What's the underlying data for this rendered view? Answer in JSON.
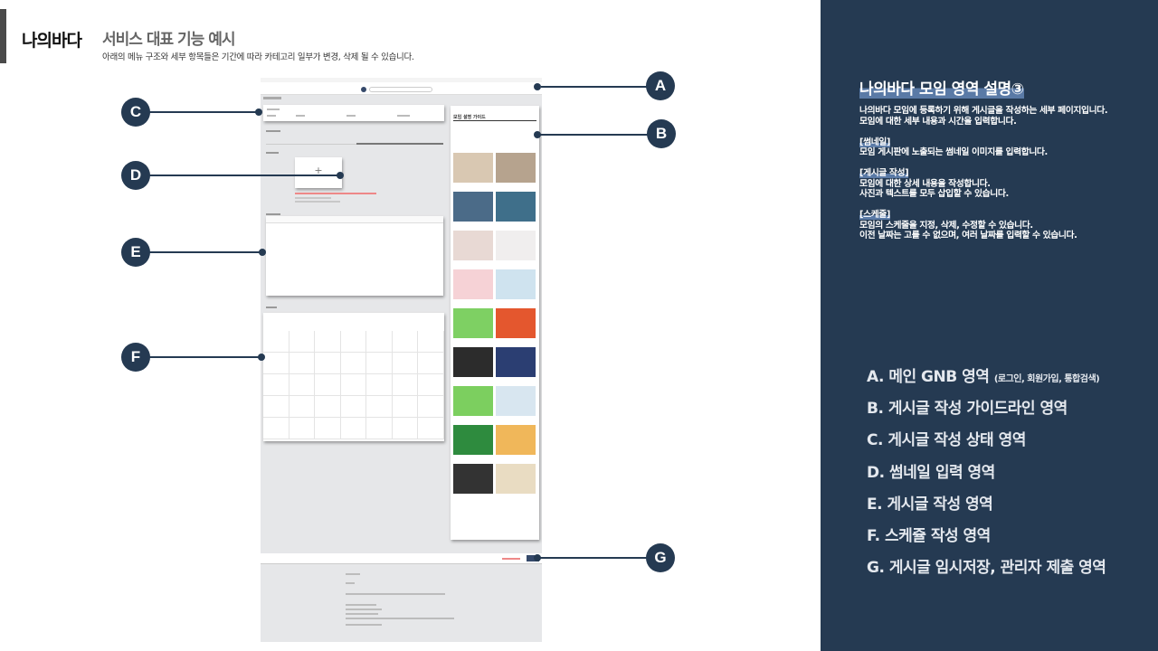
{
  "header": {
    "brand": "나의바다",
    "subtitle": "서비스 대표 기능 예시",
    "description": "아래의 메뉴 구조와 세부 항목들은 기간에 따라 카테고리 일부가 변경, 삭제 될 수 있습니다."
  },
  "mockup": {
    "guide_title": "모임 설명 가이드"
  },
  "markers": {
    "a": "A",
    "b": "B",
    "c": "C",
    "d": "D",
    "e": "E",
    "f": "F",
    "g": "G"
  },
  "panel": {
    "title": "나의바다 모임 영역 설명③",
    "intro_line1": "나의바다 모임에 등록하기 위해 게시글을 작성하는 세부 페이지입니다.",
    "intro_line2": "모임에 대한 세부 내용과 시간을 입력합니다.",
    "thumb_tag": "[썸네일]",
    "thumb_desc": "모임 게시판에 노출되는 썸네일 이미지를 입력합니다.",
    "post_tag": "[게시글 작성]",
    "post_desc1": "모임에 대한 상세 내용을 작성합니다.",
    "post_desc2": "사진과 텍스트를 모두 삽입할 수 있습니다.",
    "sched_tag": "[스케줄]",
    "sched_desc1": "모임의 스케줄을 지정, 삭제, 수정할 수 있습니다.",
    "sched_desc2": "이전 날짜는 고를 수 없으며, 여러 날짜를 입력할 수 있습니다."
  },
  "legend": {
    "a": "A. 메인 GNB 영역",
    "a_note": "(로그인, 회원가입, 통합검색)",
    "b": "B. 게시글 작성 가이드라인 영역",
    "c": "C. 게시글 작성 상태 영역",
    "d": "D. 썸네일 입력 영역",
    "e": "E. 게시글 작성 영역",
    "f": "F. 스케쥴 작성 영역",
    "g": "G. 게시글 임시저장, 관리자 제출 영역"
  },
  "colors": {
    "panel_bg": "#253a52",
    "marker": "#253a52",
    "highlight": "#5a7aa6"
  }
}
